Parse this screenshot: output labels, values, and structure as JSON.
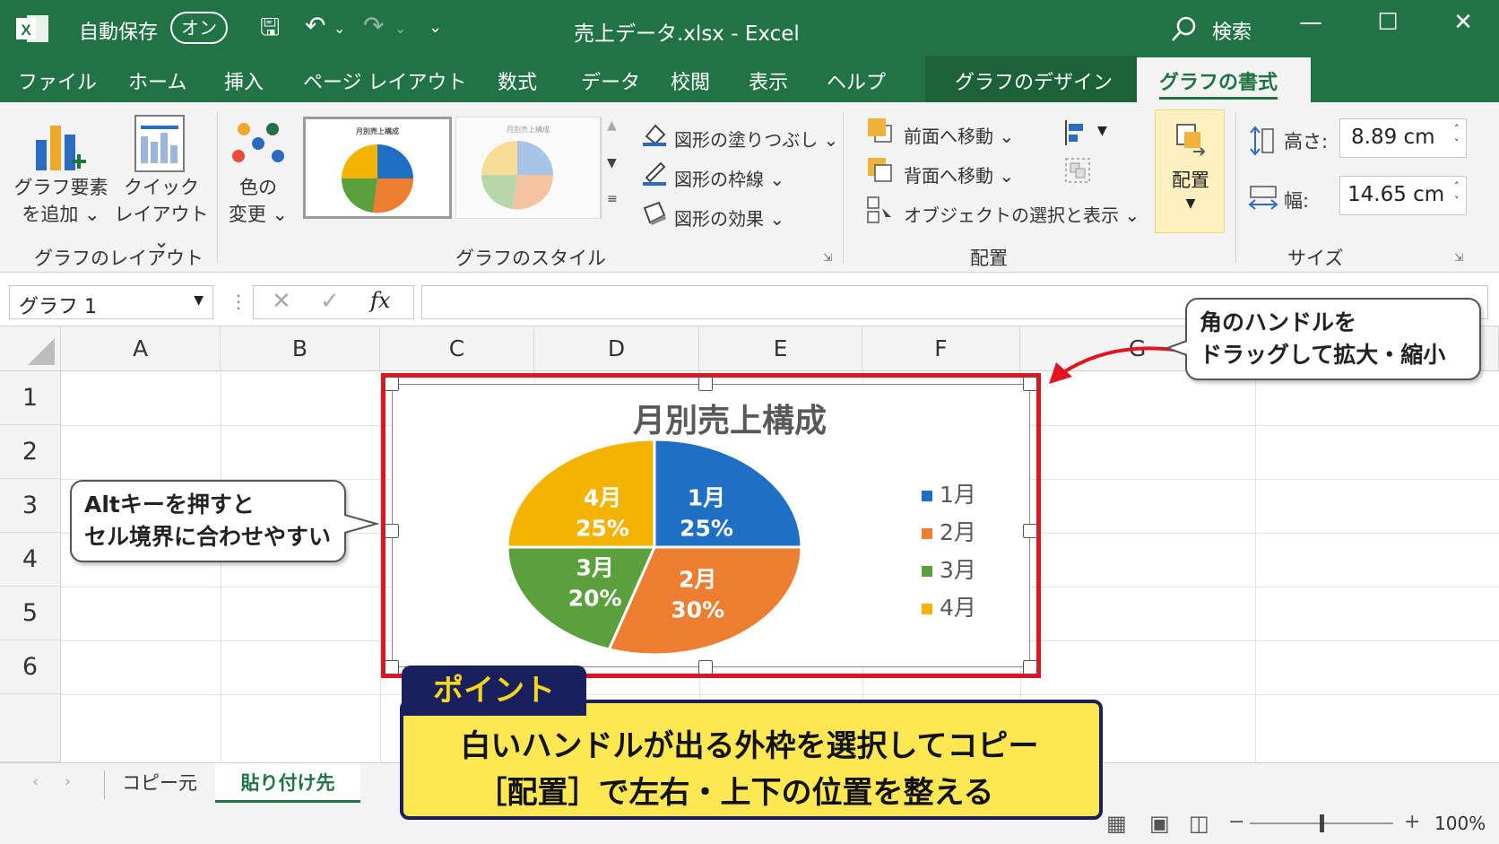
{
  "titlebar": {
    "autosave": "自動保存",
    "autosave_toggle": "オン",
    "document": "売上データ.xlsx  -  Excel",
    "search": "検索"
  },
  "tabs": [
    "ファイル",
    "ホーム",
    "挿入",
    "ページ レイアウト",
    "数式",
    "データ",
    "校閲",
    "表示",
    "ヘルプ",
    "グラフのデザイン",
    "グラフの書式"
  ],
  "ribbon": {
    "add_element": [
      "グラフ要素",
      "を追加 ⌄"
    ],
    "quick_layout": [
      "クイック",
      "レイアウト ⌄"
    ],
    "change_color": [
      "色の",
      "変更 ⌄"
    ],
    "thumb_title": "月別売上構成",
    "fill": "図形の塗りつぶし ⌄",
    "outline": "図形の枠線 ⌄",
    "effects": "図形の効果 ⌄",
    "bring_forward": "前面へ移動  ⌄",
    "send_backward": "背面へ移動  ⌄",
    "selection_pane": "オブジェクトの選択と表示 ⌄",
    "arrange": "配置",
    "height_label": "高さ:",
    "height_value": "8.89 cm",
    "width_label": "幅:",
    "width_value": "14.65 cm",
    "groups": {
      "layout": "グラフのレイアウト",
      "styles": "グラフのスタイル",
      "arrange": "配置",
      "size": "サイズ"
    }
  },
  "formula": {
    "namebox": "グラフ 1",
    "fx": "fx"
  },
  "columns": [
    "A",
    "B",
    "C",
    "D",
    "E",
    "F",
    "G"
  ],
  "rows": [
    "1",
    "2",
    "3",
    "4",
    "5",
    "6"
  ],
  "chart_data": {
    "type": "pie",
    "title": "月別売上構成",
    "categories": [
      "1月",
      "2月",
      "3月",
      "4月"
    ],
    "values": [
      25,
      30,
      20,
      25
    ],
    "labels": [
      "25%",
      "30%",
      "20%",
      "25%"
    ],
    "colors": [
      "#1f6fc5",
      "#ed7d31",
      "#5aa03c",
      "#f5b301"
    ],
    "legend": "right"
  },
  "callouts": {
    "corner": [
      "角のハンドルを",
      "ドラッグして拡大・縮小"
    ],
    "alt": [
      "Altキーを押すと",
      "セル境界に合わせやすい"
    ]
  },
  "point": {
    "tag": "ポイント",
    "line1": "白いハンドルが出る外枠を選択してコピー",
    "line2": "［配置］で左右・上下の位置を整える"
  },
  "sheets": [
    "コピー元",
    "貼り付け先"
  ],
  "status": {
    "zoom": "100%"
  }
}
